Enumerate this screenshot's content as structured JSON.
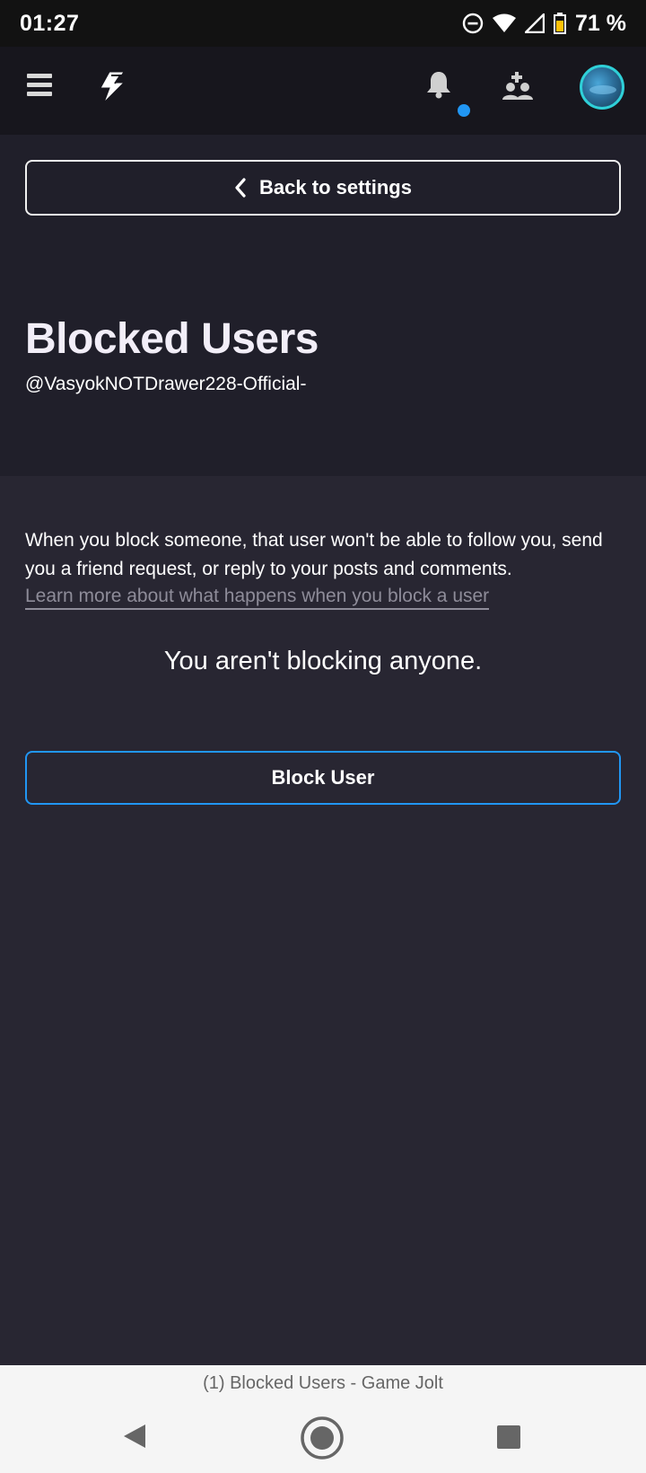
{
  "status_bar": {
    "time": "01:27",
    "battery_percent": "71 %",
    "icons": [
      "dnd-icon",
      "wifi-icon",
      "signal-icon",
      "battery-icon"
    ]
  },
  "top_nav": {
    "icons": [
      "hamburger-menu-icon",
      "game-jolt-logo-icon",
      "bell-icon",
      "friends-icon",
      "avatar"
    ],
    "notification_dot_color": "#2196f3"
  },
  "header": {
    "back_label": "Back to settings",
    "title": "Blocked Users",
    "username": "@VasyokNOTDrawer228-Official-"
  },
  "content": {
    "description": "When you block someone, that user won't be able to follow you, send you a friend request, or reply to your posts and comments.",
    "learn_more": "Learn more about what happens when you block a user",
    "empty_message": "You aren't blocking anyone.",
    "block_button": "Block User"
  },
  "browser": {
    "tab_title": "(1) Blocked Users - Game Jolt"
  },
  "colors": {
    "accent": "#2196f3",
    "background": "#282632",
    "header_background": "#201f2a"
  }
}
